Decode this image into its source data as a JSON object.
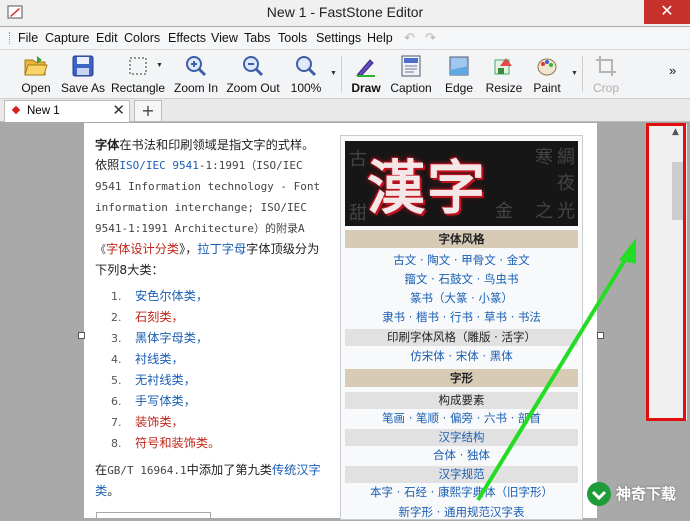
{
  "window": {
    "title": "New 1 - FastStone Editor",
    "close_glyph": "✕"
  },
  "menu": [
    "File",
    "Capture",
    "Edit",
    "Colors",
    "Effects",
    "View",
    "Tabs",
    "Tools",
    "Settings",
    "Help"
  ],
  "toolbar": {
    "open": "Open",
    "save_as": "Save As",
    "rectangle": "Rectangle",
    "zoom_in": "Zoom In",
    "zoom_out": "Zoom Out",
    "zoom_level": "100%",
    "draw": "Draw",
    "caption": "Caption",
    "edge": "Edge",
    "resize": "Resize",
    "paint": "Paint",
    "crop": "Crop",
    "more": "»"
  },
  "tabs": {
    "active": "New 1",
    "close": "✕",
    "add": "+"
  },
  "doc": {
    "intro_bold": "字体",
    "intro_rest": "在书法和印刷领域是指文字的式样。依照",
    "iso_link": "ISO/IEC 9541",
    "iso_text": "-1:1991（ISO/IEC 9541 Information technology - Font information interchange; ISO/IEC 9541-1:1991 Architecture）的附录A《",
    "design_link": "字体设计分类",
    "after_design": "》，",
    "latin_link": "拉丁字母",
    "after_latin": "字体顶级分为下列8大类：",
    "list": [
      {
        "n": "1.",
        "t": "安色尔体类，",
        "red": false
      },
      {
        "n": "2.",
        "t": "石刻类，",
        "red": true
      },
      {
        "n": "3.",
        "t": "黑体字母类，",
        "red": false
      },
      {
        "n": "4.",
        "t": "衬线类，",
        "red": false
      },
      {
        "n": "5.",
        "t": "无衬线类，",
        "red": false
      },
      {
        "n": "6.",
        "t": "手写体类，",
        "red": false
      },
      {
        "n": "7.",
        "t": "装饰类，",
        "red": true
      },
      {
        "n": "8.",
        "t": "符号和装饰类。",
        "red": true
      }
    ],
    "final_a": "在",
    "final_gb": "GB/T 16964.1",
    "final_b": "中添加了第九类",
    "final_link": "传统汉字类",
    "final_c": "。"
  },
  "infobox": {
    "banner": "漢字",
    "banner_bg": [
      "寒",
      "綢",
      "夜",
      "光",
      "古",
      "金",
      "甜",
      "之"
    ],
    "h_styles": "字体风格",
    "row1": "古文 · 陶文 · 甲骨文 · 金文",
    "row2": "籀文 · 石鼓文 · 鸟虫书",
    "row3": "篆书（大篆 · 小篆）",
    "row4": "隶书 · 楷书 · 行书 · 草书 · 书法",
    "sub_print": "印刷字体风格（雕版 · 活字）",
    "row5": "仿宋体 · 宋体 · 黑体",
    "h_shape": "字形",
    "sub_parts": "构成要素",
    "row6": "笔画 · 笔顺 · 偏旁 · 六书 · 部首",
    "sub_struct": "汉字结构",
    "row7": "合体 · 独体",
    "sub_norm": "汉字规范",
    "row8": "本字 · 石经 · 康熙字典体（旧字形）",
    "row9": "新字形 · 通用规范汉字表"
  },
  "watermark": {
    "text": "神奇下载"
  },
  "colors": {
    "highlight_box": "#e11010",
    "arrow": "#22dd22"
  }
}
